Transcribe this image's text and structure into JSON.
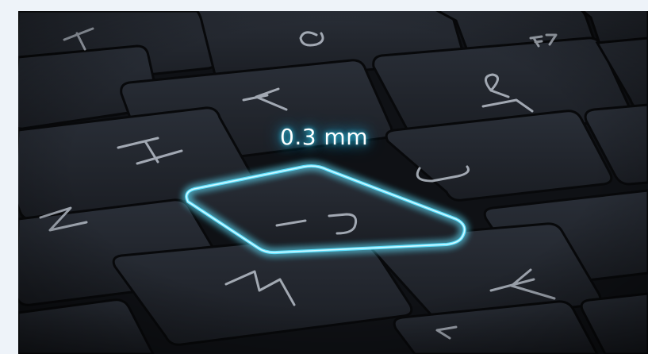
{
  "image": {
    "subject": "laptop-keyboard-closeup",
    "highlighted_key": "J",
    "accent_color": "#5fe2ff",
    "key_color": "#1e222a",
    "legend_color": "#b9c0ca"
  },
  "callout": {
    "text": "0.3 mm"
  },
  "keys": [
    {
      "name": "key-t",
      "legend": "T"
    },
    {
      "name": "key-6",
      "legend": "6"
    },
    {
      "name": "key-f7",
      "legend": "F7"
    },
    {
      "name": "key-y",
      "legend": "Y"
    },
    {
      "name": "key-7",
      "legend": "& 7"
    },
    {
      "name": "key-h",
      "legend": "H"
    },
    {
      "name": "key-u",
      "legend": "U"
    },
    {
      "name": "key-j",
      "legend": "J"
    },
    {
      "name": "key-n",
      "legend": "N"
    },
    {
      "name": "key-m",
      "legend": "M"
    },
    {
      "name": "key-k",
      "legend": "K"
    },
    {
      "name": "key-comma",
      "legend": "<"
    }
  ]
}
